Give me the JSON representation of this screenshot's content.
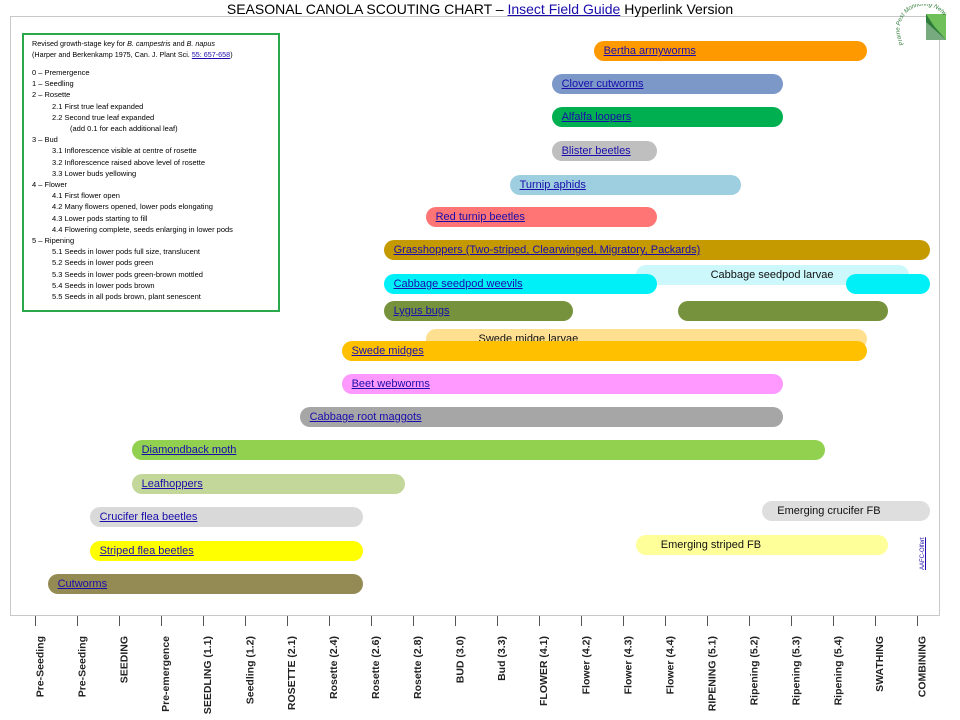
{
  "title": {
    "prefix": "SEASONAL CANOLA SCOUTING CHART –",
    "link": "Insect Field Guide",
    "suffix": "Hyperlink Version"
  },
  "logo": {
    "icon": "prairie-pest-monitoring-network-logo",
    "text": "Prairie Pest Monitoring Network"
  },
  "side_link": "AAFC-Olfert",
  "legend": {
    "ref_line1_a": "Revised growth-stage key for",
    "ref_line1_b": "B. campestris",
    "ref_line1_c": "and",
    "ref_line1_d": "B. napus",
    "ref_line2": "(Harper and Berkenkamp 1975, Can. J. Plant Sci.",
    "ref_link": "55: 657-658",
    "ref_close": ")",
    "items": [
      {
        "text": "0 – Premergence",
        "level": 0
      },
      {
        "text": "1 – Seedling",
        "level": 0
      },
      {
        "text": "2 – Rosette",
        "level": 0
      },
      {
        "text": "2.1  First true leaf expanded",
        "level": 1
      },
      {
        "text": "2.2  Second true leaf expanded",
        "level": 1
      },
      {
        "text": "(add 0.1 for each additional leaf)",
        "level": 2
      },
      {
        "text": "3 – Bud",
        "level": 0
      },
      {
        "text": "3.1  Inflorescence visible at centre of rosette",
        "level": 1
      },
      {
        "text": "3.2  Inflorescence raised above level of rosette",
        "level": 1
      },
      {
        "text": "3.3  Lower buds yellowing",
        "level": 1
      },
      {
        "text": "4 – Flower",
        "level": 0
      },
      {
        "text": "4.1  First flower open",
        "level": 1
      },
      {
        "text": "4.2  Many flowers opened, lower pods elongating",
        "level": 1
      },
      {
        "text": "4.3  Lower pods starting to fill",
        "level": 1
      },
      {
        "text": "4.4  Flowering complete, seeds enlarging in lower pods",
        "level": 1
      },
      {
        "text": "5 – Ripening",
        "level": 0
      },
      {
        "text": "5.1  Seeds in lower pods full size, translucent",
        "level": 1
      },
      {
        "text": "5.2  Seeds in lower pods green",
        "level": 1
      },
      {
        "text": "5.3  Seeds in lower pods green-brown mottled",
        "level": 1
      },
      {
        "text": "5.4  Seeds in lower pods brown",
        "level": 1
      },
      {
        "text": "5.5  Seeds in all pods brown, plant senescent",
        "level": 1
      }
    ]
  },
  "chart_data": {
    "type": "gantt",
    "title": "SEASONAL CANOLA SCOUTING CHART – Insect Field Guide Hyperlink Version",
    "categories": [
      "Pre-Seeding",
      "Pre-Seeding",
      "SEEDING",
      "Pre-emergence",
      "SEEDLING (1.1)",
      "Seedling (1.2)",
      "ROSETTE (2.1)",
      "Rosette (2.4)",
      "Rosette (2.6)",
      "Rosette (2.8)",
      "BUD (3.0)",
      "Bud (3.3)",
      "FLOWER (4.1)",
      "Flower (4.2)",
      "Flower (4.3)",
      "Flower (4.4)",
      "RIPENING (5.1)",
      "Ripening (5.2)",
      "Ripening (5.3)",
      "Ripening (5.4)",
      "SWATHING",
      "COMBINING"
    ],
    "series": [
      {
        "name": "Bertha armyworms",
        "start": 13.3,
        "end": 19.8,
        "color": "#ff9900",
        "link": true
      },
      {
        "name": "Clover cutworms",
        "start": 12.3,
        "end": 17.8,
        "color": "#7b98c9",
        "link": true
      },
      {
        "name": "Alfalfa loopers",
        "start": 12.3,
        "end": 17.8,
        "color": "#00b050",
        "link": true
      },
      {
        "name": "Blister beetles",
        "start": 12.3,
        "end": 14.8,
        "color": "#bfbfbf",
        "link": true
      },
      {
        "name": "Turnip aphids",
        "start": 11.3,
        "end": 16.8,
        "color": "#9dcfe0",
        "link": true
      },
      {
        "name": "Red turnip beetles",
        "start": 9.3,
        "end": 14.8,
        "color": "#ff7575",
        "link": true
      },
      {
        "name": "Grasshoppers (Two-striped, Clearwinged, Migratory, Packards)",
        "start": 8.3,
        "end": 21.3,
        "color": "#c49a00",
        "link": true
      },
      {
        "name": "Cabbage seedpod larvae",
        "start": 14.3,
        "end": 20.8,
        "color": "#ccf8fb",
        "link": false
      },
      {
        "name": "Cabbage seedpod weevils",
        "start": 8.3,
        "end": 14.8,
        "color": "#00f0f8",
        "link": true,
        "segments": [
          [
            8.3,
            14.8
          ],
          [
            19.3,
            21.3
          ]
        ]
      },
      {
        "name": "Lygus bugs",
        "start": 8.3,
        "end": 12.8,
        "color": "#76923c",
        "link": true,
        "segments": [
          [
            8.3,
            12.8
          ],
          [
            15.3,
            20.3
          ]
        ]
      },
      {
        "name": "Swede midge larvae",
        "start": 9.3,
        "end": 19.8,
        "color": "#ffe090",
        "link": false
      },
      {
        "name": "Swede midges",
        "start": 7.3,
        "end": 19.8,
        "color": "#ffc000",
        "link": true
      },
      {
        "name": "Beet webworms",
        "start": 7.3,
        "end": 17.8,
        "color": "#ff99ff",
        "link": true
      },
      {
        "name": "Cabbage root maggots",
        "start": 6.3,
        "end": 17.8,
        "color": "#a6a6a6",
        "link": true
      },
      {
        "name": "Diamondback moth",
        "start": 2.3,
        "end": 18.8,
        "color": "#92d050",
        "link": true
      },
      {
        "name": "Leafhoppers",
        "start": 2.3,
        "end": 8.8,
        "color": "#c4d79b",
        "link": true
      },
      {
        "name": "Crucifer flea beetles",
        "start": 1.3,
        "end": 7.8,
        "color": "#d9d9d9",
        "link": true
      },
      {
        "name": "Emerging crucifer FB",
        "start": 17.3,
        "end": 21.3,
        "color": "#dedede",
        "link": false
      },
      {
        "name": "Emerging striped FB",
        "start": 14.3,
        "end": 20.3,
        "color": "#ffff99",
        "link": false
      },
      {
        "name": "Striped flea beetles",
        "start": 1.3,
        "end": 7.8,
        "color": "#ffff00",
        "link": true
      },
      {
        "name": "Cutworms",
        "start": 0.3,
        "end": 7.8,
        "color": "#948a54",
        "link": true
      }
    ],
    "grid": false,
    "legend": "none"
  }
}
